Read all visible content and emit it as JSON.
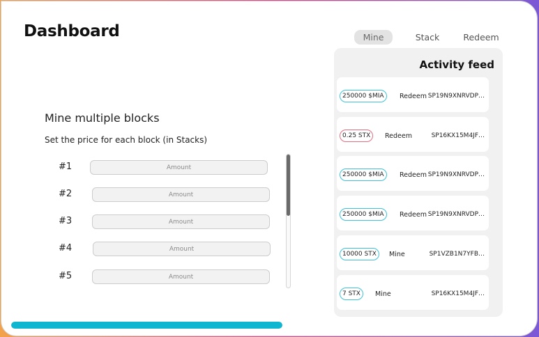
{
  "header": {
    "title": "Dashboard"
  },
  "tabs": [
    {
      "label": "Mine",
      "active": true
    },
    {
      "label": "Stack",
      "active": false
    },
    {
      "label": "Redeem",
      "active": false
    }
  ],
  "mine": {
    "title": "Mine multiple blocks",
    "subtitle": "Set the price for each block (in Stacks)",
    "blocks": [
      {
        "label": "#1",
        "placeholder": "Amount"
      },
      {
        "label": "#2",
        "placeholder": "Amount"
      },
      {
        "label": "#3",
        "placeholder": "Amount"
      },
      {
        "label": "#4",
        "placeholder": "Amount"
      },
      {
        "label": "#5",
        "placeholder": "Amount"
      }
    ]
  },
  "progress": {
    "fraction": 1.0
  },
  "feed": {
    "title": "Activity feed",
    "items": [
      {
        "amount": "250000 $MIA",
        "action": "Redeem",
        "address": "SP19N9XNRVDP…",
        "badge_color": "#3cc3d6"
      },
      {
        "amount": "0.25 STX",
        "action": "Redeem",
        "address": "SP16KX15M4JF…",
        "badge_color": "#e06d80"
      },
      {
        "amount": "250000 $MIA",
        "action": "Redeem",
        "address": "SP19N9XNRVDP…",
        "badge_color": "#3cc3d6"
      },
      {
        "amount": "250000 $MIA",
        "action": "Redeem",
        "address": "SP19N9XNRVDP…",
        "badge_color": "#3cc3d6"
      },
      {
        "amount": "10000 STX",
        "action": "Mine",
        "address": "SP1VZB1N7YFB…",
        "badge_color": "#3cc3d6"
      },
      {
        "amount": "7 STX",
        "action": "Mine",
        "address": "SP16KX15M4JF…",
        "badge_color": "#3cc3d6"
      }
    ]
  },
  "colors": {
    "accent": "#0fb6cf",
    "badge_cyan": "#3cc3d6",
    "badge_red": "#e06d80"
  }
}
